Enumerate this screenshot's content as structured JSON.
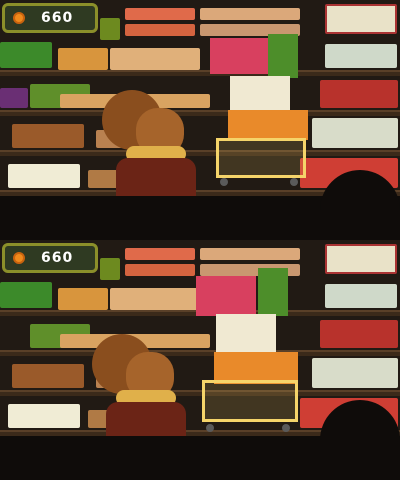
{
  "game": {
    "coin_count_top": "660",
    "coin_count_bottom": "660",
    "colors": {
      "background": "#211a14",
      "shelf": "#3b2a1a",
      "coin": "#f08a1c",
      "counter_border": "#8c8f2a",
      "counter_bg": "#2f3a22",
      "shopper_hair": "#8a4e1e",
      "shopper_coat": "#6b2416"
    },
    "icons": {
      "coin": "coin-icon",
      "cart": "shopping-cart-icon"
    }
  }
}
